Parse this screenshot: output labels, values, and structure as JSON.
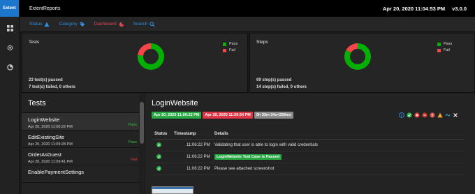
{
  "rail": {
    "brand": "Extent",
    "icons": [
      "grid-icon",
      "gear-icon",
      "dashboard-icon"
    ]
  },
  "topbar": {
    "title": "ExtentReports",
    "datetime": "Apr 20, 2020 11:04:53 PM",
    "version": "v3.0.0"
  },
  "nav": {
    "status": "Status",
    "category": "Category",
    "dashboard": "Dashboard",
    "search": "Search"
  },
  "tests_card": {
    "title": "Tests",
    "legend_pass": "Pass",
    "legend_fail": "Fail",
    "passed": "23 test(s) passed",
    "failed": "7 test(s) failed, 0 others",
    "pass_count": 23,
    "fail_count": 7
  },
  "steps_card": {
    "title": "Steps",
    "legend_pass": "Pass",
    "legend_fail": "Fail",
    "passed": "69 step(s) passed",
    "failed": "14 step(s) failed, 0 others",
    "pass_count": 69,
    "fail_count": 14
  },
  "colors": {
    "pass": "#00af00",
    "fail": "#f7464a",
    "accent": "#1b76cc"
  },
  "list": {
    "header": "Tests",
    "items": [
      {
        "name": "LoginWebsite",
        "time": "Apr 20, 2020 11:06:22 PM",
        "status": "Pass"
      },
      {
        "name": "EditExistingSite",
        "time": "Apr 20, 2020 11:09:28 PM",
        "status": "Pass"
      },
      {
        "name": "OrderAsGuest",
        "time": "Apr 20, 2020 11:09:41 PM",
        "status": "Fail"
      },
      {
        "name": "EnablePaymentSettings",
        "time": "",
        "status": ""
      }
    ]
  },
  "detail": {
    "title": "LoginWebsite",
    "start": "Apr 20, 2020 11:06:22 PM",
    "end": "Apr 20, 2020 11:39:54 PM",
    "duration": "0h 33m 34s+258ms",
    "columns": [
      "Status",
      "Timestamp",
      "Details"
    ],
    "rows": [
      {
        "time": "11:06:22 PM",
        "details": "Validating that user is able to login with valid credentials"
      },
      {
        "time": "11:06:22 PM",
        "details": "LoginWebsite Test Case is Passed"
      },
      {
        "time": "11:06:22 PM",
        "details": "Please see attached screenshot"
      }
    ]
  }
}
